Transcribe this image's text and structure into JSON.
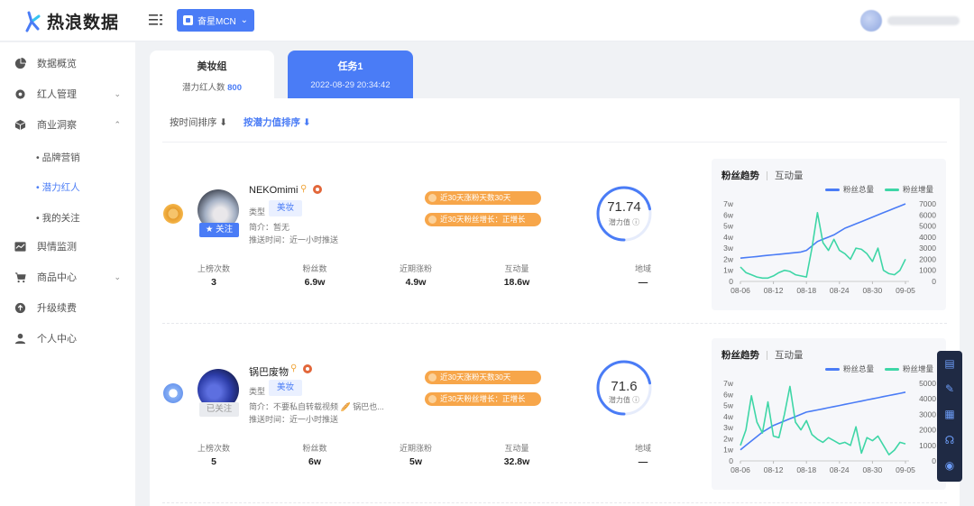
{
  "app": {
    "logo_text": "热浪数据",
    "org_select": "奋星MCN",
    "brand_color": "#4a7cf6"
  },
  "sidebar": {
    "items": [
      {
        "label": "数据概览",
        "icon": "pie-chart-icon"
      },
      {
        "label": "红人管理",
        "icon": "gear-icon"
      },
      {
        "label": "商业洞察",
        "icon": "cube-icon"
      },
      {
        "label": "舆情监测",
        "icon": "line-chart-icon"
      },
      {
        "label": "商品中心",
        "icon": "cart-icon"
      },
      {
        "label": "升级续费",
        "icon": "upgrade-icon"
      },
      {
        "label": "个人中心",
        "icon": "user-icon"
      }
    ],
    "sub_items": [
      "• 品牌营销",
      "• 潜力红人",
      "• 我的关注"
    ]
  },
  "tabs": [
    {
      "title": "美妆组",
      "sub_label": "潜力红人数",
      "sub_value": "800"
    },
    {
      "title": "任务1",
      "sub_label": "2022-08-29 20:34:42"
    }
  ],
  "sort": {
    "by_time": "按时间排序 ⬇",
    "by_potential": "按潜力值排序 ⬇"
  },
  "kols": [
    {
      "name": "NEKOmimi",
      "follow_label": "★ 关注",
      "followed": false,
      "type_label": "类型",
      "type": "美妆",
      "intro": "简介：暂无",
      "push_time": "推送时间：近一小时推送",
      "badge1": "近30天涨粉天数30天",
      "badge2": "近30天粉丝增长：正增长",
      "score": "71.74",
      "score_label": "潜力值 ⓘ",
      "score_fraction": 0.72,
      "stats": [
        {
          "label": "上榜次数",
          "value": "3"
        },
        {
          "label": "粉丝数",
          "value": "6.9w"
        },
        {
          "label": "近期涨粉",
          "value": "4.9w"
        },
        {
          "label": "互动量",
          "value": "18.6w"
        },
        {
          "label": "地域",
          "value": "—"
        }
      ],
      "chart": {
        "tab_active": "粉丝趋势",
        "tab_other": "互动量",
        "legend_total": "粉丝总量",
        "legend_growth": "粉丝增量",
        "left_ticks": [
          "7w",
          "6w",
          "5w",
          "4w",
          "3w",
          "2w",
          "1w",
          "0"
        ],
        "right_ticks": [
          "7000",
          "6000",
          "5000",
          "4000",
          "3000",
          "2000",
          "1000",
          "0"
        ],
        "x_ticks": [
          "08-06",
          "08-12",
          "08-18",
          "08-24",
          "08-30",
          "09-05"
        ]
      }
    },
    {
      "name": "锅巴废物",
      "follow_label": "已关注",
      "followed": true,
      "type_label": "类型",
      "type": "美妆",
      "intro": "简介：不要私自转载视频 🥖 锅巴也...",
      "push_time": "推送时间：近一小时推送",
      "badge1": "近30天涨粉天数30天",
      "badge2": "近30天粉丝增长：正增长",
      "score": "71.6",
      "score_label": "潜力值 ⓘ",
      "score_fraction": 0.72,
      "stats": [
        {
          "label": "上榜次数",
          "value": "5"
        },
        {
          "label": "粉丝数",
          "value": "6w"
        },
        {
          "label": "近期涨粉",
          "value": "5w"
        },
        {
          "label": "互动量",
          "value": "32.8w"
        },
        {
          "label": "地域",
          "value": "—"
        }
      ],
      "chart": {
        "tab_active": "粉丝趋势",
        "tab_other": "互动量",
        "legend_total": "粉丝总量",
        "legend_growth": "粉丝增量",
        "left_ticks": [
          "7w",
          "6w",
          "5w",
          "4w",
          "3w",
          "2w",
          "1w",
          "0"
        ],
        "right_ticks": [
          "5000",
          "4000",
          "3000",
          "2000",
          "1000",
          "0"
        ],
        "x_ticks": [
          "08-06",
          "08-12",
          "08-18",
          "08-24",
          "08-30",
          "09-05"
        ]
      }
    }
  ],
  "chart_data": [
    {
      "type": "line",
      "x": [
        "08-06",
        "08-07",
        "08-08",
        "08-09",
        "08-10",
        "08-11",
        "08-12",
        "08-13",
        "08-14",
        "08-15",
        "08-16",
        "08-17",
        "08-18",
        "08-19",
        "08-20",
        "08-21",
        "08-22",
        "08-23",
        "08-24",
        "08-25",
        "08-26",
        "08-27",
        "08-28",
        "08-29",
        "08-30",
        "08-31",
        "09-01",
        "09-02",
        "09-03",
        "09-04",
        "09-05"
      ],
      "ylim": [
        0,
        70000
      ],
      "y2lim": [
        0,
        7000
      ],
      "series": [
        {
          "name": "粉丝总量",
          "axis": "left",
          "color": "#4a7cf6",
          "values": [
            21000,
            21500,
            22000,
            22500,
            23000,
            23500,
            24000,
            24500,
            25000,
            25500,
            26000,
            26500,
            28000,
            32000,
            36000,
            38000,
            40000,
            42000,
            45000,
            48000,
            50000,
            52000,
            54000,
            56000,
            58000,
            60000,
            62000,
            64000,
            66000,
            68000,
            70000
          ]
        },
        {
          "name": "粉丝增量",
          "axis": "right",
          "color": "#3ed6a6",
          "values": [
            1300,
            800,
            600,
            400,
            300,
            300,
            500,
            800,
            1000,
            900,
            600,
            500,
            400,
            3000,
            6200,
            3500,
            2800,
            3800,
            2800,
            2500,
            2000,
            3000,
            2900,
            2500,
            1800,
            3000,
            1000,
            700,
            600,
            1000,
            2000
          ]
        }
      ]
    },
    {
      "type": "line",
      "x": [
        "08-06",
        "08-07",
        "08-08",
        "08-09",
        "08-10",
        "08-11",
        "08-12",
        "08-13",
        "08-14",
        "08-15",
        "08-16",
        "08-17",
        "08-18",
        "08-19",
        "08-20",
        "08-21",
        "08-22",
        "08-23",
        "08-24",
        "08-25",
        "08-26",
        "08-27",
        "08-28",
        "08-29",
        "08-30",
        "08-31",
        "09-01",
        "09-02",
        "09-03",
        "09-04",
        "09-05"
      ],
      "ylim": [
        0,
        70000
      ],
      "y2lim": [
        0,
        5000
      ],
      "series": [
        {
          "name": "粉丝总量",
          "axis": "left",
          "color": "#4a7cf6",
          "values": [
            10000,
            14000,
            18000,
            22000,
            26000,
            29000,
            32000,
            34000,
            36000,
            38000,
            40000,
            42000,
            44000,
            45000,
            46000,
            47000,
            48000,
            49000,
            50000,
            51000,
            52000,
            53000,
            54000,
            55000,
            56000,
            57000,
            58000,
            59000,
            60000,
            61000,
            62000
          ]
        },
        {
          "name": "粉丝增量",
          "axis": "right",
          "color": "#3ed6a6",
          "values": [
            1000,
            2000,
            4200,
            2500,
            1800,
            3800,
            1600,
            1500,
            3000,
            4800,
            2500,
            2000,
            2600,
            1700,
            1400,
            1200,
            1500,
            1300,
            1100,
            1200,
            1000,
            2200,
            500,
            1500,
            1300,
            1600,
            1000,
            400,
            700,
            1200,
            1100
          ]
        }
      ]
    }
  ],
  "float_bar": {
    "icons": [
      "chat-icon",
      "edit-icon",
      "doc-icon",
      "headset-icon",
      "coins-icon"
    ]
  }
}
